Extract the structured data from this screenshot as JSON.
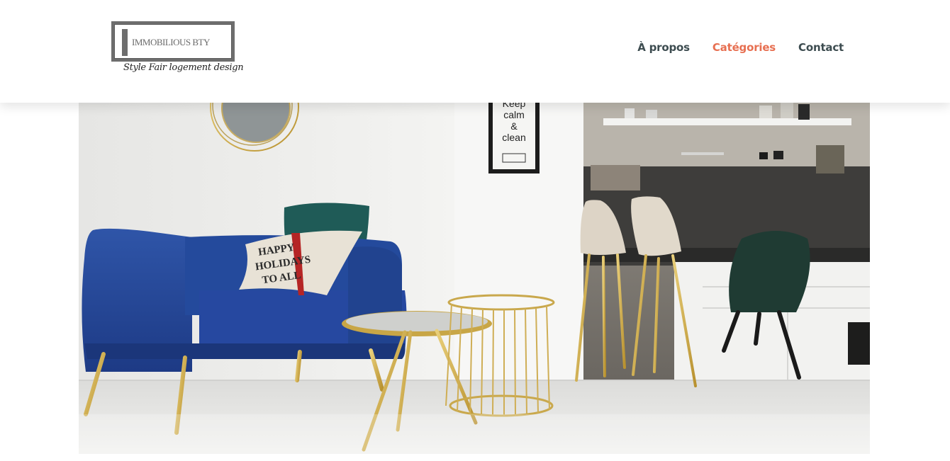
{
  "header": {
    "logo": {
      "title": "IMMOBILIOUS BTY",
      "tagline": "Style Fair logement design"
    },
    "nav": [
      {
        "label": "À propos",
        "active": false
      },
      {
        "label": "Catégories",
        "active": true
      },
      {
        "label": "Contact",
        "active": false
      }
    ],
    "accent_color": "#e76f51",
    "nav_color": "#3d4c50"
  },
  "hero": {
    "poster_text": [
      "Keep",
      "calm",
      "&",
      "clean"
    ],
    "pillow_text": [
      "HAPPY",
      "HOLIDAYS",
      "TO ALL"
    ]
  }
}
